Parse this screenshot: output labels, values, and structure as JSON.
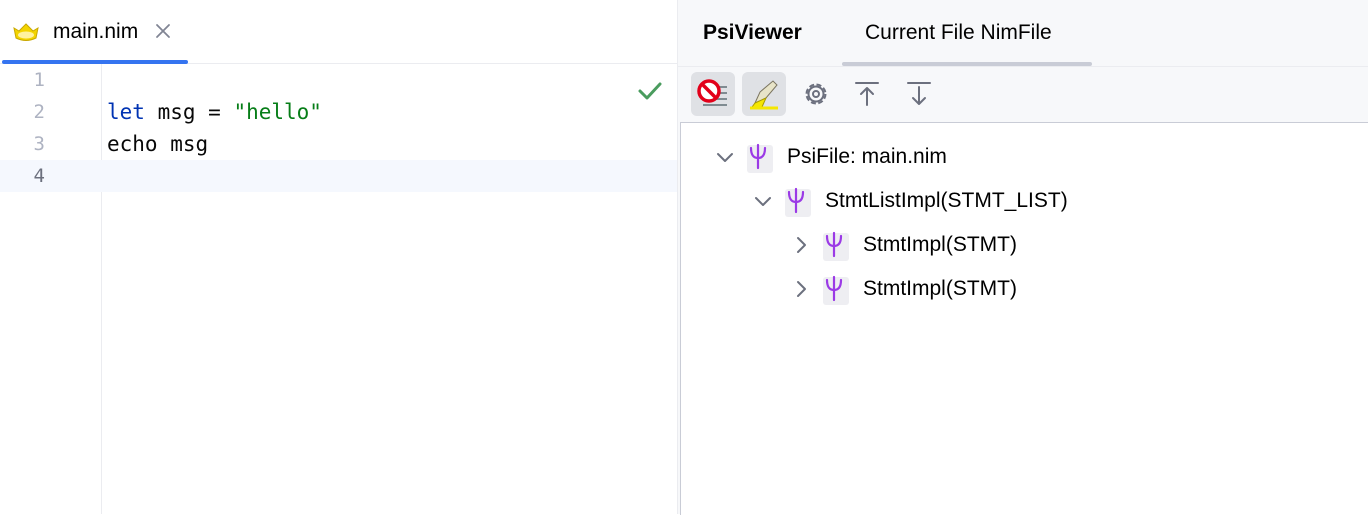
{
  "editor": {
    "tab": {
      "filename": "main.nim",
      "icon": "nim-crown-icon",
      "close_icon": "close-icon"
    },
    "lines": [
      {
        "number": "1",
        "tokens": []
      },
      {
        "number": "2",
        "tokens": [
          {
            "text": "let",
            "kind": "keyword"
          },
          {
            "text": " msg = ",
            "kind": "plain"
          },
          {
            "text": "\"hello\"",
            "kind": "string"
          }
        ]
      },
      {
        "number": "3",
        "tokens": [
          {
            "text": "echo msg",
            "kind": "plain"
          }
        ]
      },
      {
        "number": "4",
        "tokens": []
      }
    ],
    "current_line": "4",
    "status_icon": "check-icon"
  },
  "psiviewer": {
    "title": "PsiViewer",
    "tab_label": "Current File NimFile",
    "toolbar": [
      {
        "name": "disable-highlight-button",
        "icon": "no-entry-icon",
        "active": true
      },
      {
        "name": "highlight-button",
        "icon": "highlighter-icon",
        "active": true
      },
      {
        "name": "settings-button",
        "icon": "gear-icon",
        "active": false
      },
      {
        "name": "scroll-from-source-button",
        "icon": "arrow-up-bar-icon",
        "active": false
      },
      {
        "name": "scroll-to-source-button",
        "icon": "arrow-down-bar-icon",
        "active": false
      }
    ],
    "tree": [
      {
        "label": "PsiFile: main.nim",
        "depth": 0,
        "expanded": true
      },
      {
        "label": "StmtListImpl(STMT_LIST)",
        "depth": 1,
        "expanded": true
      },
      {
        "label": "StmtImpl(STMT)",
        "depth": 2,
        "expanded": false
      },
      {
        "label": "StmtImpl(STMT)",
        "depth": 2,
        "expanded": false
      }
    ]
  },
  "colors": {
    "keyword": "#0033b3",
    "string": "#067d17",
    "accent": "#3574f0",
    "psi_icon": "#9b3ae6",
    "check": "#4a9c5e"
  }
}
